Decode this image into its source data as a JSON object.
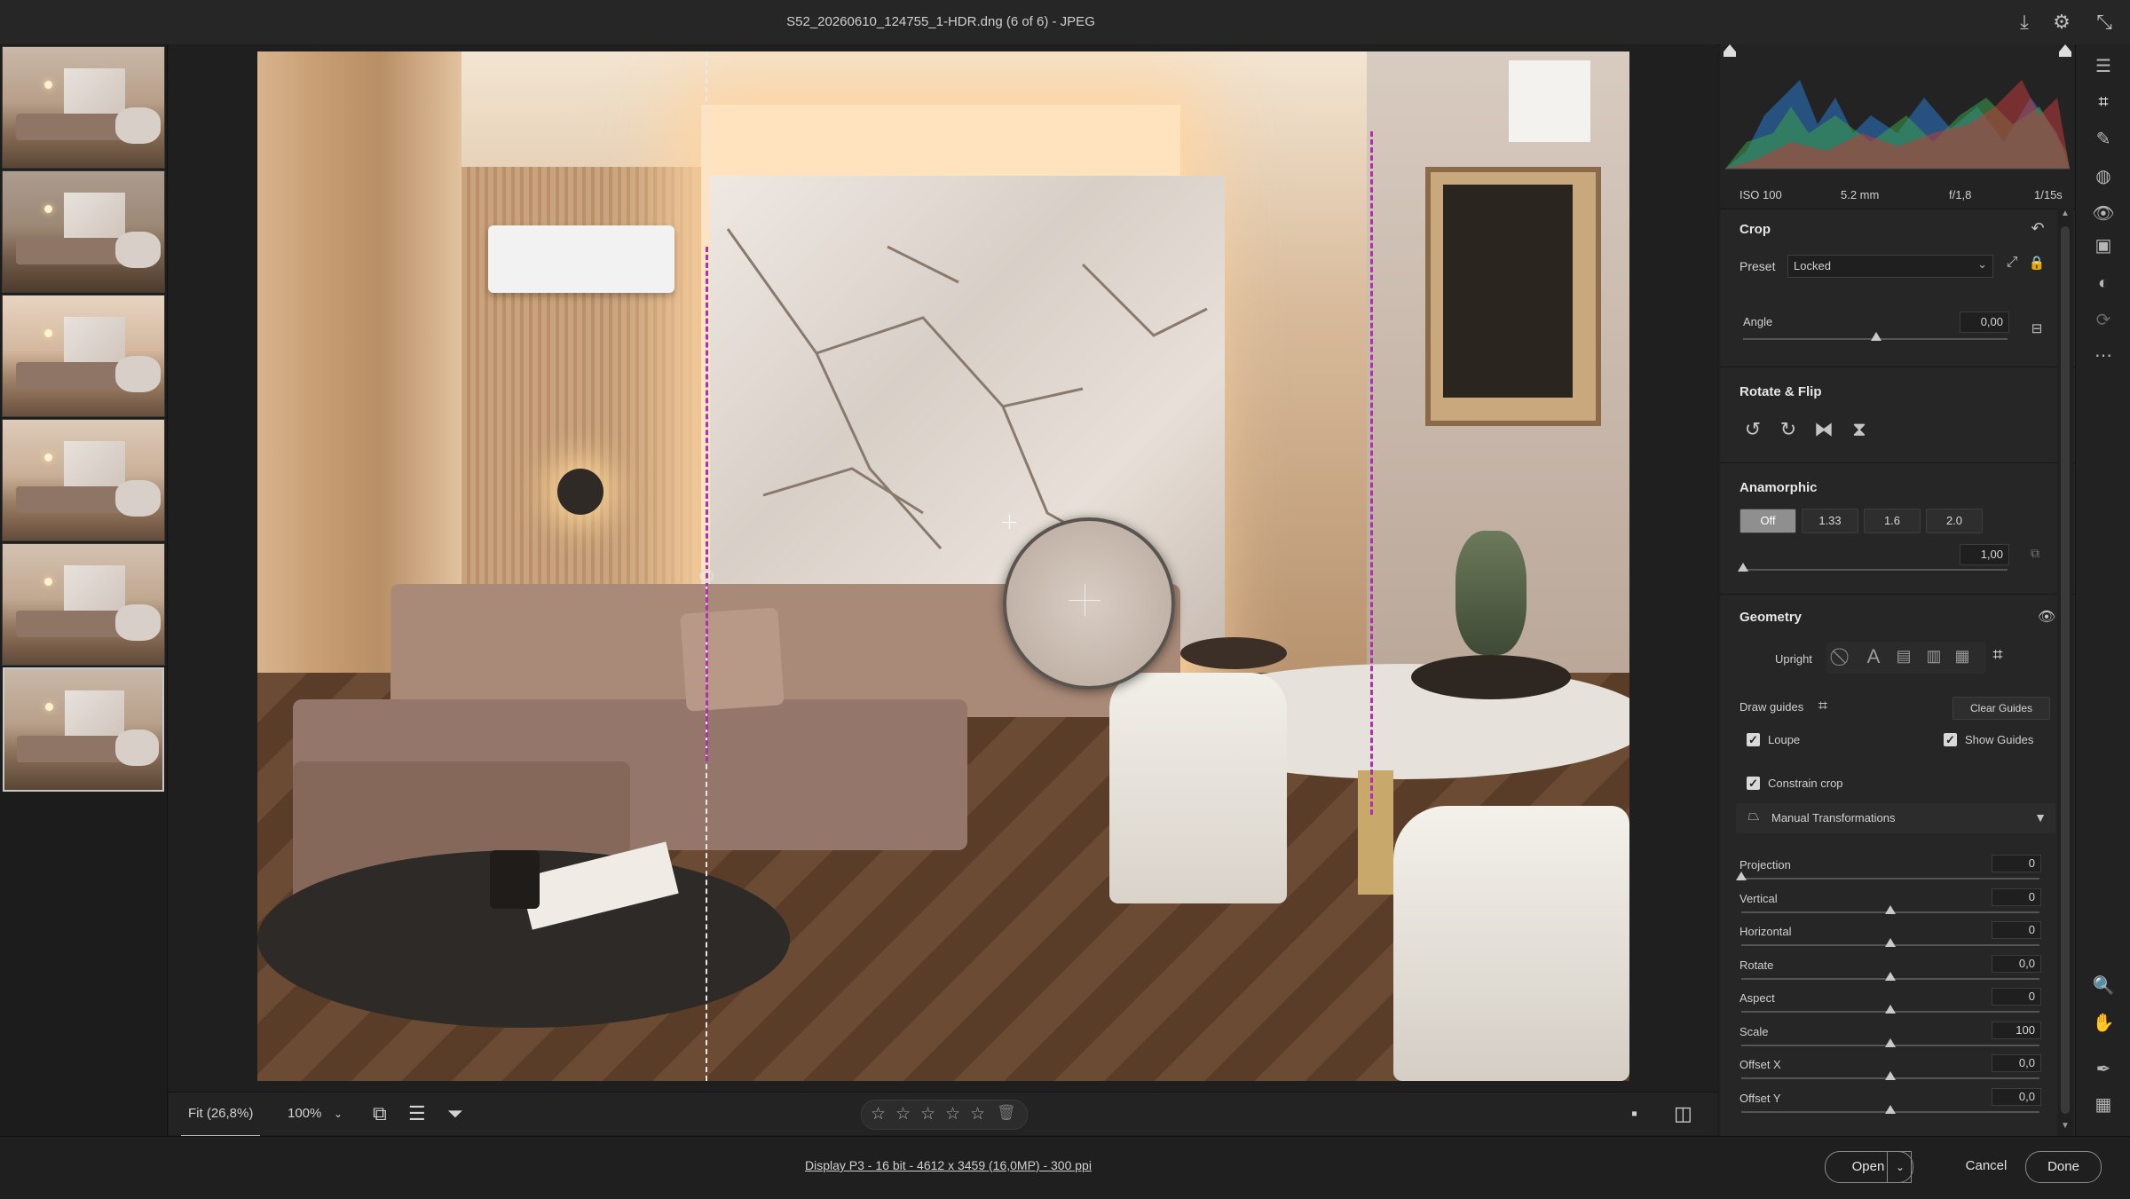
{
  "window": {
    "title": "S52_20260610_124755_1-HDR.dng (6 of 6)  -  JPEG"
  },
  "histogram": {
    "iso": "ISO 100",
    "focal": "5.2 mm",
    "aperture": "f/1,8",
    "shutter": "1/15s"
  },
  "crop": {
    "title": "Crop",
    "preset_label": "Preset",
    "preset_value": "Locked",
    "angle_label": "Angle",
    "angle_value": "0,00"
  },
  "rotate": {
    "title": "Rotate & Flip"
  },
  "anamorphic": {
    "title": "Anamorphic",
    "options": [
      "Off",
      "1.33",
      "1.6",
      "2.0"
    ],
    "selected": "Off",
    "value": "1,00"
  },
  "geometry": {
    "title": "Geometry",
    "upright_label": "Upright",
    "draw_guides_label": "Draw guides",
    "clear_guides": "Clear Guides",
    "loupe_label": "Loupe",
    "show_guides_label": "Show Guides",
    "constrain_label": "Constrain crop",
    "manual_label": "Manual Transformations",
    "sliders": [
      {
        "label": "Projection",
        "value": "0",
        "level": 0.0
      },
      {
        "label": "Vertical",
        "value": "0",
        "level": 0.5
      },
      {
        "label": "Horizontal",
        "value": "0",
        "level": 0.5
      },
      {
        "label": "Rotate",
        "value": "0,0",
        "level": 0.5
      },
      {
        "label": "Aspect",
        "value": "0",
        "level": 0.5
      },
      {
        "label": "Scale",
        "value": "100",
        "level": 0.5
      },
      {
        "label": "Offset X",
        "value": "0,0",
        "level": 0.5
      },
      {
        "label": "Offset Y",
        "value": "0,0",
        "level": 0.5
      }
    ]
  },
  "viewbar": {
    "fit": "Fit (26,8%)",
    "zoom": "100%"
  },
  "status": {
    "info": "Display P3 - 16 bit - 4612 x 3459 (16,0MP) - 300 ppi",
    "open": "Open",
    "cancel": "Cancel",
    "done": "Done"
  },
  "rating": {
    "stars": [
      "☆",
      "☆",
      "☆",
      "☆",
      "☆"
    ],
    "value": 0
  },
  "icons": {
    "download": "download-icon",
    "settings": "gear-icon",
    "collapse": "collapse-icon",
    "trash": "trash-icon"
  },
  "colors": {
    "accent": "#8f8f8f",
    "guide": "#b030b0"
  }
}
